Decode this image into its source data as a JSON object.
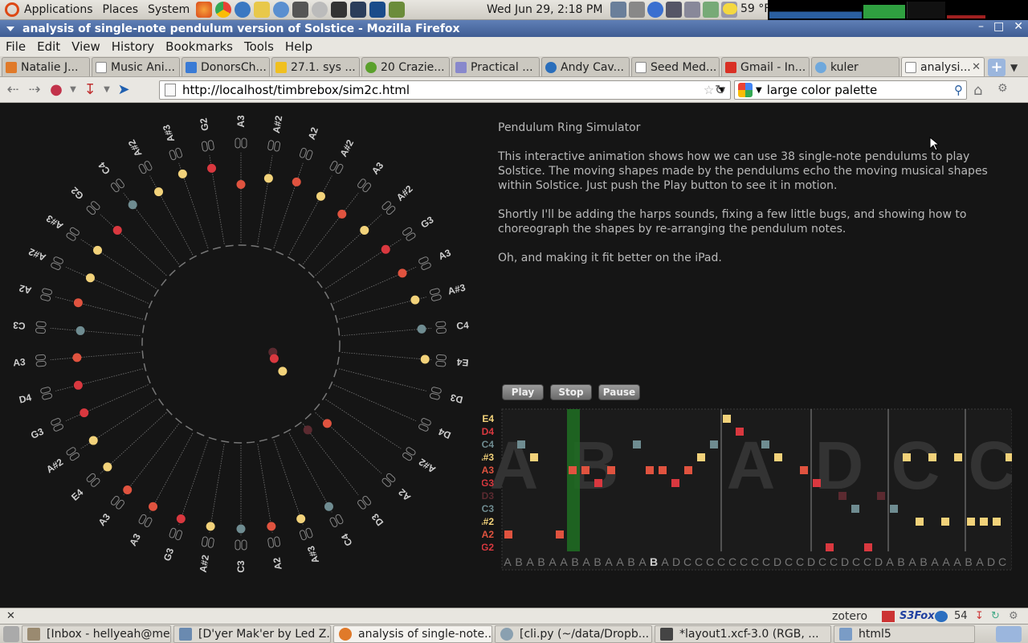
{
  "gnome_panel": {
    "menus": [
      "Applications",
      "Places",
      "System"
    ],
    "clock": "Wed Jun 29,  2:18 PM",
    "weather": "59 °F"
  },
  "window": {
    "title": "analysis of single-note pendulum version of Solstice - Mozilla Firefox"
  },
  "menubar": [
    "File",
    "Edit",
    "View",
    "History",
    "Bookmarks",
    "Tools",
    "Help"
  ],
  "tabs": [
    {
      "label": "Natalie J...",
      "color": "#e07a2a"
    },
    {
      "label": "Music Ani...",
      "color": "#ffffff"
    },
    {
      "label": "DonorsCh...",
      "color": "#3a7bd5"
    },
    {
      "label": "27.1. sys ...",
      "color": "#f0c020"
    },
    {
      "label": "20 Crazie...",
      "color": "#5aa02c"
    },
    {
      "label": "Practical ...",
      "color": "#8888cc"
    },
    {
      "label": "Andy Cav...",
      "color": "#2a6ebb"
    },
    {
      "label": "Seed Med...",
      "color": "#ffffff"
    },
    {
      "label": "Gmail - In...",
      "color": "#d93025"
    },
    {
      "label": "kuler",
      "color": "#6fa8dc"
    },
    {
      "label": "analysi...",
      "color": "#ffffff"
    }
  ],
  "navbar": {
    "url": "http://localhost/timbrebox/sim2c.html",
    "search": "large color palette"
  },
  "page": {
    "heading": "Pendulum Ring Simulator",
    "paragraphs": [
      "This interactive animation shows how we can use 38 single-note pendulums to play Solstice. The moving shapes made by the pendulums echo the moving musical shapes within Solstice. Just push the Play button to see it in motion.",
      "Shortly I'll be adding the harps sounds, fixing a few little bugs, and showing how to choreograph the shapes by re-arranging the pendulum notes.",
      "Oh, and making it fit better on the iPad."
    ],
    "buttons": {
      "play": "Play",
      "stop": "Stop",
      "pause": "Pause"
    },
    "ring_labels": [
      "A3",
      "A#2",
      "A2",
      "A#2",
      "A3",
      "A#2",
      "G3",
      "A3",
      "A#3",
      "C4",
      "E4",
      "D3",
      "D4",
      "A#2",
      "A2",
      "D3",
      "C4",
      "A#3",
      "A2",
      "C3",
      "A#2",
      "G3",
      "A3",
      "A3",
      "E4",
      "A#2",
      "G3",
      "D4",
      "A3",
      "C3",
      "A2",
      "A#2",
      "A#3",
      "G2",
      "C4",
      "A#2",
      "A#3",
      "G2"
    ],
    "row_labels": [
      {
        "label": "E4",
        "color": "#f2d27a"
      },
      {
        "label": "D4",
        "color": "#d9383f"
      },
      {
        "label": "C4",
        "color": "#6f8c91"
      },
      {
        "label": "A#3",
        "color": "#f2d27a"
      },
      {
        "label": "A3",
        "color": "#e0533f"
      },
      {
        "label": "G3",
        "color": "#d9383f"
      },
      {
        "label": "D3",
        "color": "#5b2a30"
      },
      {
        "label": "C3",
        "color": "#6f8c91"
      },
      {
        "label": "A#2",
        "color": "#f2d27a"
      },
      {
        "label": "A2",
        "color": "#e0533f"
      },
      {
        "label": "G2",
        "color": "#d9383f"
      }
    ],
    "sequence": "ABABAABABAABABADCCCCCCCCDCCDCCDCCDABABAAABADCC",
    "section_letters": [
      "A",
      "B",
      "A",
      "D",
      "C",
      "C"
    ]
  },
  "statusbar": {
    "zotero": "zotero",
    "s3fox": "S3Fox",
    "count": "54"
  },
  "taskbar": [
    {
      "label": "[Inbox - hellyeah@me...",
      "color": "#9a8a70"
    },
    {
      "label": "[D'yer Mak'er by Led Z...",
      "color": "#6a8ab0"
    },
    {
      "label": "analysis of single-note...",
      "color": "#e07a2a"
    },
    {
      "label": "[cli.py (~/data/Dropb...",
      "color": "#8aa0b0"
    },
    {
      "label": "*layout1.xcf-3.0 (RGB, ...",
      "color": "#444444"
    },
    {
      "label": "html5",
      "color": "#7a9cc6"
    }
  ]
}
